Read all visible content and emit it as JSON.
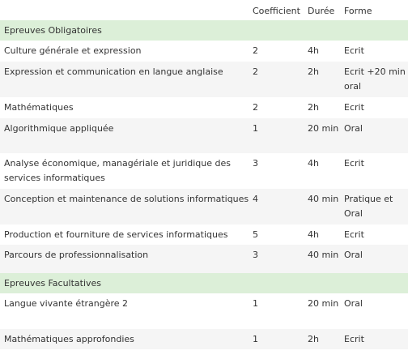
{
  "headers": {
    "subject": "",
    "coefficient": "Coefficient",
    "duree": "Durée",
    "forme": "Forme"
  },
  "colors": {
    "section_background": "#dcefd8",
    "alternate_row_background": "#f5f5f5"
  },
  "sections": [
    {
      "title": "Epreuves Obligatoires",
      "rows": [
        {
          "subject": "Culture générale et expression",
          "coefficient": "2",
          "duree": "4h",
          "forme": "Ecrit"
        },
        {
          "subject": "Expression et communication en langue anglaise",
          "coefficient": "2",
          "duree": "2h",
          "forme": "Ecrit +20 min oral"
        },
        {
          "subject": "Mathématiques",
          "coefficient": "2",
          "duree": "2h",
          "forme": "Ecrit"
        },
        {
          "subject": "Algorithmique appliquée",
          "coefficient": "1",
          "duree": "20 min",
          "forme": "Oral"
        },
        {
          "subject": "Analyse économique, managériale et juridique des services informatiques",
          "coefficient": "3",
          "duree": "4h",
          "forme": "Ecrit"
        },
        {
          "subject": "Conception et maintenance de solutions informatiques",
          "coefficient": "4",
          "duree": "40 min",
          "forme": "Pratique et Oral"
        },
        {
          "subject": "Production et fourniture de services informatiques",
          "coefficient": "5",
          "duree": "4h",
          "forme": "Ecrit"
        },
        {
          "subject": "Parcours de professionnalisation",
          "coefficient": "3",
          "duree": "40 min",
          "forme": "Oral"
        }
      ]
    },
    {
      "title": "Epreuves Facultatives",
      "rows": [
        {
          "subject": "Langue vivante étrangère 2",
          "coefficient": "1",
          "duree": "20 min",
          "forme": "Oral"
        },
        {
          "subject": "Mathématiques approfondies",
          "coefficient": "1",
          "duree": "2h",
          "forme": "Ecrit"
        }
      ]
    }
  ]
}
